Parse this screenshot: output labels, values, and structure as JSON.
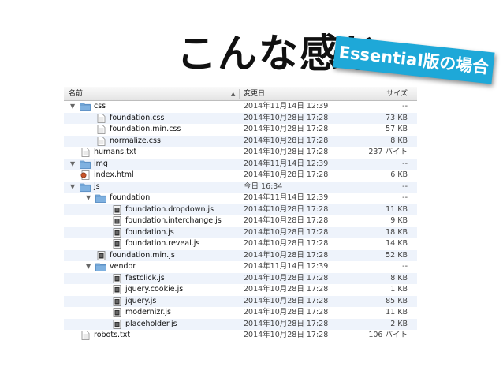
{
  "slide": {
    "title": "こんな感じ",
    "badge": "Essential版の場合"
  },
  "columns": {
    "name": "名前",
    "sort_indicator": "▲",
    "modified": "変更日",
    "size": "サイズ"
  },
  "rows": [
    {
      "name": "css",
      "date": "2014年11月14日 12:39",
      "size": "--",
      "type": "folder",
      "depth": 0,
      "expanded": true
    },
    {
      "name": "foundation.css",
      "date": "2014年10月28日 17:28",
      "size": "73 KB",
      "type": "doc",
      "depth": 1
    },
    {
      "name": "foundation.min.css",
      "date": "2014年10月28日 17:28",
      "size": "57 KB",
      "type": "doc",
      "depth": 1
    },
    {
      "name": "normalize.css",
      "date": "2014年10月28日 17:28",
      "size": "8 KB",
      "type": "doc",
      "depth": 1
    },
    {
      "name": "humans.txt",
      "date": "2014年10月28日 17:28",
      "size": "237 バイト",
      "type": "doc",
      "depth": 0
    },
    {
      "name": "img",
      "date": "2014年11月14日 12:39",
      "size": "--",
      "type": "folder",
      "depth": 0,
      "expanded": true
    },
    {
      "name": "index.html",
      "date": "2014年10月28日 17:28",
      "size": "6 KB",
      "type": "html",
      "depth": 0
    },
    {
      "name": "js",
      "date": "今日 16:34",
      "size": "--",
      "type": "folder",
      "depth": 0,
      "expanded": true
    },
    {
      "name": "foundation",
      "date": "2014年11月14日 12:39",
      "size": "--",
      "type": "folder",
      "depth": 1,
      "expanded": true
    },
    {
      "name": "foundation.dropdown.js",
      "date": "2014年10月28日 17:28",
      "size": "11 KB",
      "type": "script",
      "depth": 2
    },
    {
      "name": "foundation.interchange.js",
      "date": "2014年10月28日 17:28",
      "size": "9 KB",
      "type": "script",
      "depth": 2
    },
    {
      "name": "foundation.js",
      "date": "2014年10月28日 17:28",
      "size": "18 KB",
      "type": "script",
      "depth": 2
    },
    {
      "name": "foundation.reveal.js",
      "date": "2014年10月28日 17:28",
      "size": "14 KB",
      "type": "script",
      "depth": 2
    },
    {
      "name": "foundation.min.js",
      "date": "2014年10月28日 17:28",
      "size": "52 KB",
      "type": "script",
      "depth": 1
    },
    {
      "name": "vendor",
      "date": "2014年11月14日 12:39",
      "size": "--",
      "type": "folder",
      "depth": 1,
      "expanded": true
    },
    {
      "name": "fastclick.js",
      "date": "2014年10月28日 17:28",
      "size": "8 KB",
      "type": "script",
      "depth": 2
    },
    {
      "name": "jquery.cookie.js",
      "date": "2014年10月28日 17:28",
      "size": "1 KB",
      "type": "script",
      "depth": 2
    },
    {
      "name": "jquery.js",
      "date": "2014年10月28日 17:28",
      "size": "85 KB",
      "type": "script",
      "depth": 2
    },
    {
      "name": "modernizr.js",
      "date": "2014年10月28日 17:28",
      "size": "11 KB",
      "type": "script",
      "depth": 2
    },
    {
      "name": "placeholder.js",
      "date": "2014年10月28日 17:28",
      "size": "2 KB",
      "type": "script",
      "depth": 2
    },
    {
      "name": "robots.txt",
      "date": "2014年10月28日 17:28",
      "size": "106 バイト",
      "type": "doc",
      "depth": 0
    }
  ],
  "colors": {
    "badge": "#1ea8d8",
    "folder": "#7fb1e0",
    "stripe": "#eef3fb"
  }
}
